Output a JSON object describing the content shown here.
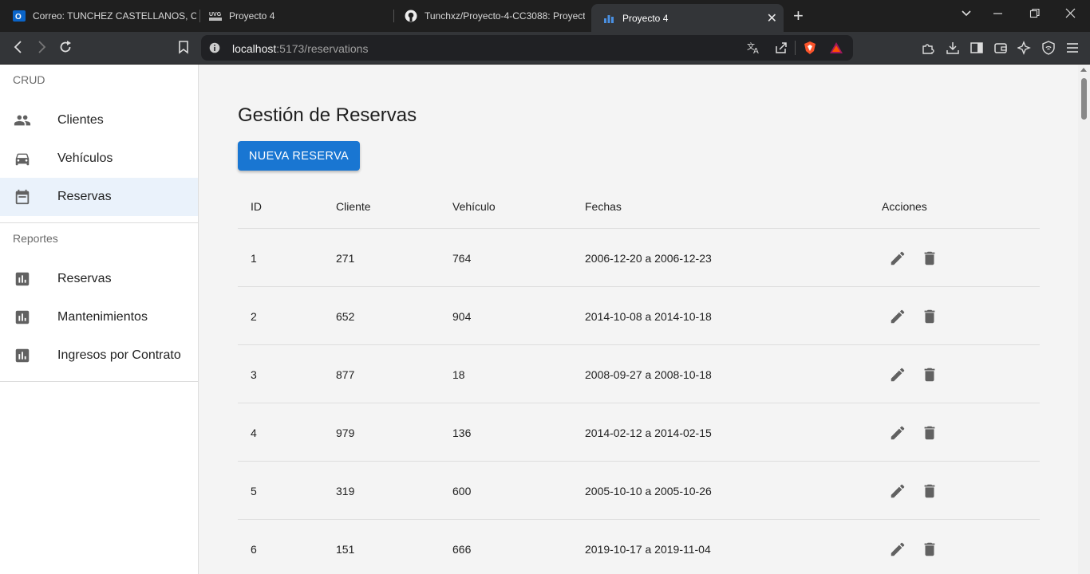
{
  "browser": {
    "tabs": [
      {
        "title": "Correo: TUNCHEZ CASTELLANOS, CR"
      },
      {
        "title": "Proyecto 4"
      },
      {
        "title": "Tunchxz/Proyecto-4-CC3088: Proyect"
      },
      {
        "title": "Proyecto 4"
      }
    ],
    "url_host": "localhost",
    "url_rest": ":5173/reservations"
  },
  "sidebar": {
    "crud_title": "CRUD",
    "crud_items": [
      {
        "label": "Clientes",
        "icon": "people-icon"
      },
      {
        "label": "Vehículos",
        "icon": "car-icon"
      },
      {
        "label": "Reservas",
        "icon": "calendar-icon",
        "selected": true
      }
    ],
    "reports_title": "Reportes",
    "report_items": [
      {
        "label": "Reservas",
        "icon": "bar-chart-icon"
      },
      {
        "label": "Mantenimientos",
        "icon": "bar-chart-icon"
      },
      {
        "label": "Ingresos por Contrato",
        "icon": "bar-chart-icon"
      }
    ]
  },
  "main": {
    "title": "Gestión de Reservas",
    "new_button": "NUEVA RESERVA",
    "columns": [
      "ID",
      "Cliente",
      "Vehículo",
      "Fechas",
      "Acciones"
    ],
    "rows": [
      [
        "1",
        "271",
        "764",
        "2006-12-20 a 2006-12-23"
      ],
      [
        "2",
        "652",
        "904",
        "2014-10-08 a 2014-10-18"
      ],
      [
        "3",
        "877",
        "18",
        "2008-09-27 a 2008-10-18"
      ],
      [
        "4",
        "979",
        "136",
        "2014-02-12 a 2014-02-15"
      ],
      [
        "5",
        "319",
        "600",
        "2005-10-10 a 2005-10-26"
      ],
      [
        "6",
        "151",
        "666",
        "2019-10-17 a 2019-11-04"
      ]
    ]
  },
  "colors": {
    "primary": "#1976d2",
    "selected_bg": "#eaf2fb",
    "icon": "#616161"
  }
}
